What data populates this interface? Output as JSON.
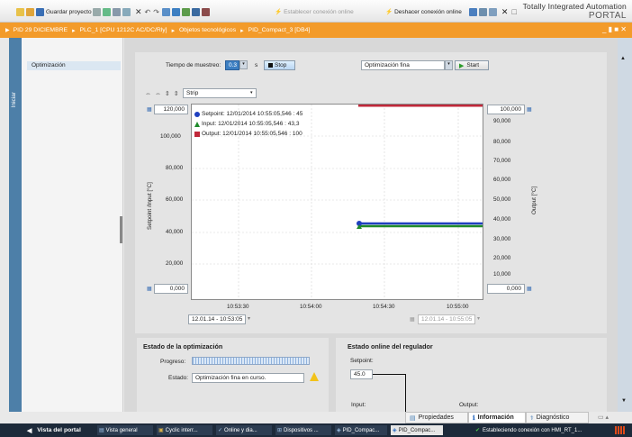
{
  "toolbar": {
    "save_label": "Guardar proyecto",
    "connect_label": "Establecer conexión online",
    "disconnect_label": "Deshacer conexión online",
    "brand_line1": "Totally Integrated Automation",
    "brand_line2": "PORTAL"
  },
  "breadcrumb": {
    "items": [
      "PID 29 DICIEMBRE",
      "PLC_1 [CPU 1212C AC/DC/Rly]",
      "Objetos tecnológicos",
      "PID_Compact_3 [DB4]"
    ],
    "controls": "_ ▮ ■ ✕"
  },
  "left_strip": {
    "label": "Iniciar"
  },
  "nav": {
    "selected_item": "Optimización"
  },
  "sampling": {
    "label": "Tiempo de muestreo:",
    "value": "0.3",
    "unit": "s",
    "stop_label": "Stop"
  },
  "tuning_mode": {
    "selected": "Optimización fina",
    "start_label": "Start"
  },
  "trend": {
    "mode": "Strip",
    "left_top_value": "120,000",
    "left_bottom_value": "0,000",
    "right_top_value": "100,000",
    "right_bottom_value": "0,000",
    "left_axis_label": "Setpoint /Input [°C]",
    "right_axis_label": "Output [°C]",
    "left_ticks": [
      "100,000",
      "80,000",
      "60,000",
      "40,000",
      "20,000"
    ],
    "right_ticks": [
      "90,000",
      "80,000",
      "70,000",
      "60,000",
      "50,000",
      "40,000",
      "30,000",
      "20,000",
      "10,000"
    ],
    "x_ticks": [
      "10:53:30",
      "10:54:00",
      "10:54:30",
      "10:55:00"
    ],
    "time_start": "12.01.14 - 10:53:05",
    "time_end": "12.01.14 - 10:55:05",
    "legend": [
      {
        "label": "Setpoint:  12/01/2014 10:55:05,546 : 45",
        "color": "#1f3fbf"
      },
      {
        "label": "Input:  12/01/2014 10:55:05,546 : 43,3",
        "color": "#1f8a2a"
      },
      {
        "label": "Output:  12/01/2014 10:55:05,546 : 100",
        "color": "#c0283a"
      }
    ]
  },
  "optimization_state": {
    "title": "Estado de la optimización",
    "progress_label": "Progreso:",
    "status_label": "Estado:",
    "status_value": "Optimización fina en curso."
  },
  "online_state": {
    "title": "Estado online del regulador",
    "setpoint_label": "Setpoint:",
    "setpoint_value": "45.0",
    "input_label": "Input:",
    "output_label": "Output:"
  },
  "inspector_tabs": {
    "properties": "Propiedades",
    "info": "Información",
    "diagnostics": "Diagnóstico"
  },
  "taskbar": {
    "portal_view": "Vista del portal",
    "items": [
      "Vista general",
      "Cyclic interr...",
      "Online y dia...",
      "Dispositivos ...",
      "PID_Compac...",
      "PID_Compac..."
    ],
    "status": "Estableciendo conexión con HMI_RT_1..."
  },
  "colors": {
    "accent_orange": "#f39b2a",
    "setpoint": "#1f3fbf",
    "input": "#1f8a2a",
    "output": "#c0283a"
  }
}
